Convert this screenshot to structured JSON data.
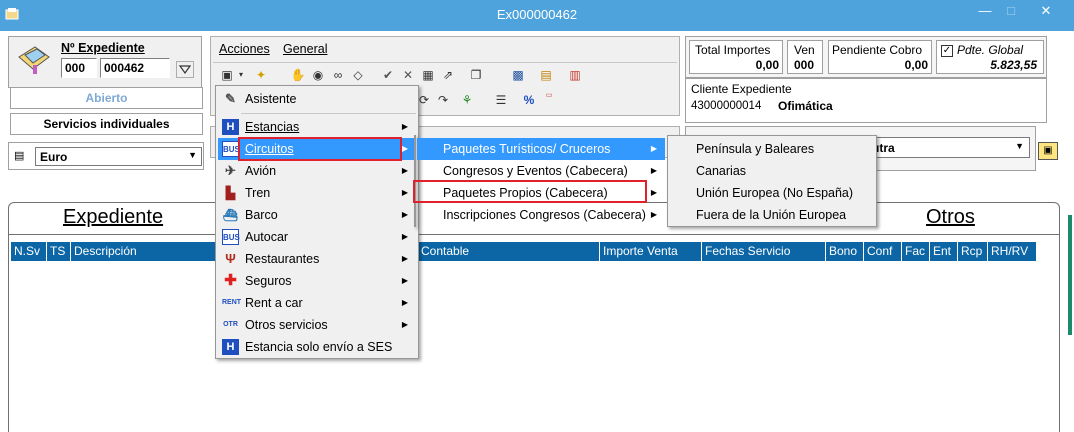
{
  "window": {
    "title": "Ex000000462",
    "minimize": "—",
    "maximize": "□",
    "close": "✕"
  },
  "expediente": {
    "label": "Nº Expediente",
    "prefix": "000",
    "number": "000462",
    "status": "Abierto",
    "type": "Servicios individuales",
    "currency": "Euro"
  },
  "menubar": {
    "acciones": "Acciones",
    "general": "General"
  },
  "totals": {
    "total_importes_label": "Total Importes",
    "total_importes_value": "0,00",
    "ven_label": "Ven",
    "ven_value": "000",
    "pendiente_label": "Pendiente Cobro",
    "pendiente_value": "0,00",
    "pdte_label": "Pdte. Global",
    "pdte_value": "5.823,55"
  },
  "cliente": {
    "label": "Cliente Expediente",
    "code": "43000000014",
    "name": "Ofimática"
  },
  "partial_select": "utra",
  "tabs": {
    "expediente": "Expediente",
    "otros": "Otros"
  },
  "grid": {
    "columns": [
      "N.Sv",
      "TS",
      "Descripción",
      "Contable",
      "Importe Venta",
      "Fechas Servicio",
      "Bono",
      "Conf",
      "Fac",
      "Ent",
      "Rcp",
      "RH/RV"
    ]
  },
  "menu1": {
    "items": [
      {
        "label": "Asistente",
        "icon": "wand-icon"
      },
      {
        "label": "Estancias",
        "icon": "hotel-icon"
      },
      {
        "label": "Circuitos",
        "icon": "bus-icon"
      },
      {
        "label": "Avión",
        "icon": "plane-icon"
      },
      {
        "label": "Tren",
        "icon": "train-icon"
      },
      {
        "label": "Barco",
        "icon": "ship-icon"
      },
      {
        "label": "Autocar",
        "icon": "coach-icon"
      },
      {
        "label": "Restaurantes",
        "icon": "restaurant-icon"
      },
      {
        "label": "Seguros",
        "icon": "insurance-cross-icon"
      },
      {
        "label": "Rent a car",
        "icon": "rent-car-icon"
      },
      {
        "label": "Otros servicios",
        "icon": "other-services-icon"
      },
      {
        "label": "Estancia solo envío a SES",
        "icon": "hotel-icon"
      }
    ]
  },
  "menu2": {
    "items": [
      {
        "label": "Paquetes Turísticos/ Cruceros"
      },
      {
        "label": "Congresos y Eventos (Cabecera)"
      },
      {
        "label": "Paquetes Propios (Cabecera)"
      },
      {
        "label": "Inscripciones Congresos (Cabecera)"
      }
    ]
  },
  "menu3": {
    "items": [
      {
        "label": "Península y Baleares"
      },
      {
        "label": "Canarias"
      },
      {
        "label": "Unión Europea (No España)"
      },
      {
        "label": "Fuera de la Unión Europea"
      }
    ]
  },
  "colors": {
    "titlebar": "#4fa3dc",
    "menu_highlight": "#3399ff",
    "grid_header": "#0c66a6",
    "annotation": "#e0202a"
  }
}
